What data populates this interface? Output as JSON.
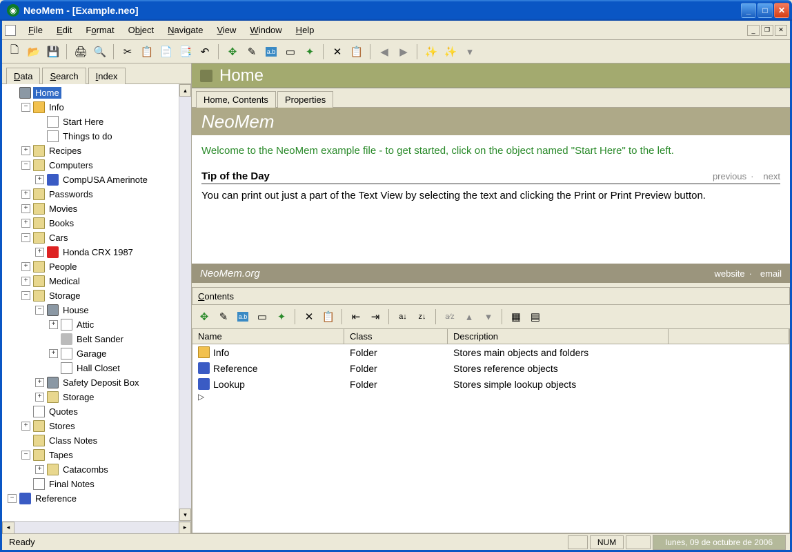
{
  "window": {
    "title": "NeoMem - [Example.neo]"
  },
  "menus": [
    "File",
    "Edit",
    "Format",
    "Object",
    "Navigate",
    "View",
    "Window",
    "Help"
  ],
  "left": {
    "tabs": [
      "Data",
      "Search",
      "Index"
    ],
    "tree": [
      {
        "level": 0,
        "expander": "",
        "iconClass": "ic-cube",
        "label": "Home",
        "selected": true
      },
      {
        "level": 1,
        "expander": "−",
        "iconClass": "ic-folder-y",
        "label": "Info"
      },
      {
        "level": 2,
        "expander": "",
        "iconClass": "ic-doc",
        "label": "Start Here"
      },
      {
        "level": 2,
        "expander": "",
        "iconClass": "ic-doc",
        "label": "Things to do"
      },
      {
        "level": 1,
        "expander": "+",
        "iconClass": "ic-folder-o",
        "label": "Recipes"
      },
      {
        "level": 1,
        "expander": "−",
        "iconClass": "ic-folder-o",
        "label": "Computers"
      },
      {
        "level": 2,
        "expander": "+",
        "iconClass": "ic-blue",
        "label": "CompUSA Amerinote"
      },
      {
        "level": 1,
        "expander": "+",
        "iconClass": "ic-folder-o",
        "label": "Passwords"
      },
      {
        "level": 1,
        "expander": "+",
        "iconClass": "ic-folder-o",
        "label": "Movies"
      },
      {
        "level": 1,
        "expander": "+",
        "iconClass": "ic-folder-o",
        "label": "Books"
      },
      {
        "level": 1,
        "expander": "−",
        "iconClass": "ic-folder-o",
        "label": "Cars"
      },
      {
        "level": 2,
        "expander": "+",
        "iconClass": "ic-red",
        "label": "Honda CRX 1987"
      },
      {
        "level": 1,
        "expander": "+",
        "iconClass": "ic-folder-o",
        "label": "People"
      },
      {
        "level": 1,
        "expander": "+",
        "iconClass": "ic-folder-o",
        "label": "Medical"
      },
      {
        "level": 1,
        "expander": "−",
        "iconClass": "ic-folder-o",
        "label": "Storage"
      },
      {
        "level": 2,
        "expander": "−",
        "iconClass": "ic-cube",
        "label": "House"
      },
      {
        "level": 3,
        "expander": "+",
        "iconClass": "ic-doc",
        "label": "Attic"
      },
      {
        "level": 3,
        "expander": "",
        "iconClass": "ic-wrench",
        "label": "Belt Sander"
      },
      {
        "level": 3,
        "expander": "+",
        "iconClass": "ic-doc",
        "label": "Garage"
      },
      {
        "level": 3,
        "expander": "",
        "iconClass": "ic-doc",
        "label": "Hall Closet"
      },
      {
        "level": 2,
        "expander": "+",
        "iconClass": "ic-cube",
        "label": "Safety Deposit Box"
      },
      {
        "level": 2,
        "expander": "+",
        "iconClass": "ic-folder-o",
        "label": "Storage"
      },
      {
        "level": 1,
        "expander": "",
        "iconClass": "ic-doc",
        "label": "Quotes"
      },
      {
        "level": 1,
        "expander": "+",
        "iconClass": "ic-folder-o",
        "label": "Stores"
      },
      {
        "level": 1,
        "expander": "",
        "iconClass": "ic-folder-o",
        "label": "Class Notes"
      },
      {
        "level": 1,
        "expander": "−",
        "iconClass": "ic-folder-o",
        "label": "Tapes"
      },
      {
        "level": 2,
        "expander": "+",
        "iconClass": "ic-folder-o",
        "label": "Catacombs"
      },
      {
        "level": 1,
        "expander": "",
        "iconClass": "ic-doc",
        "label": "Final Notes"
      },
      {
        "level": 0,
        "expander": "−",
        "iconClass": "ic-blue",
        "label": "Reference"
      }
    ]
  },
  "header": {
    "title": "Home"
  },
  "subTabs": [
    "Home, Contents",
    "Properties"
  ],
  "brand": "NeoMem",
  "welcome": "Welcome to the NeoMem example file - to get started, click on the object named \"Start Here\" to the left.",
  "tip": {
    "heading": "Tip of the Day",
    "prev": "previous",
    "next": "next",
    "body": "You can print out just a part of the Text View by selecting the text and clicking the Print or Print Preview button."
  },
  "org": {
    "name": "NeoMem.org",
    "website": "website",
    "email": "email"
  },
  "contents": {
    "label": "Contents",
    "columns": [
      "Name",
      "Class",
      "Description"
    ],
    "rows": [
      {
        "icon": "ic-folder-y",
        "name": "Info",
        "class": "Folder",
        "desc": "Stores main objects and folders"
      },
      {
        "icon": "ic-blue",
        "name": "Reference",
        "class": "Folder",
        "desc": "Stores reference objects"
      },
      {
        "icon": "ic-blue",
        "name": "Lookup",
        "class": "Folder",
        "desc": "Stores simple lookup objects"
      }
    ]
  },
  "status": {
    "ready": "Ready",
    "num": "NUM",
    "date": "lunes, 09 de octubre de 2006"
  }
}
